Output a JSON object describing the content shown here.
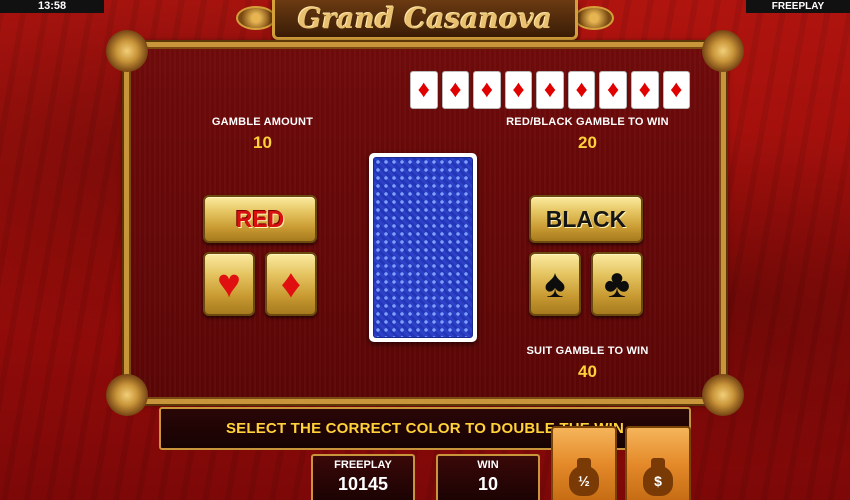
{
  "status_bar": {
    "time": "13:58",
    "mode": "FREEPLAY"
  },
  "title": "Grand Casanova",
  "history": {
    "cards": [
      "♦",
      "♦",
      "♦",
      "♦",
      "♦",
      "♦",
      "♦",
      "♦",
      "♦"
    ],
    "suit": "diamond",
    "color": "#e00000"
  },
  "gamble_amount": {
    "label": "GAMBLE AMOUNT",
    "value": "10"
  },
  "red_black_win": {
    "label": "RED/BLACK GAMBLE TO WIN",
    "value": "20"
  },
  "suit_win": {
    "label": "SUIT GAMBLE TO WIN",
    "value": "40"
  },
  "buttons": {
    "red": "RED",
    "black": "BLACK",
    "heart": "♥",
    "diamond": "♦",
    "spade": "♠",
    "club": "♣"
  },
  "message": "SELECT THE CORRECT COLOR TO DOUBLE THE WIN",
  "footer": {
    "freeplay_label": "FREEPLAY",
    "freeplay_value": "10145",
    "win_label": "WIN",
    "win_value": "10",
    "half_gamble_symbol": "½",
    "collect_symbol": "$"
  },
  "colors": {
    "accent_gold": "#c9953a",
    "value_yellow": "#ffd23a",
    "background_red": "#9a0d0a"
  }
}
